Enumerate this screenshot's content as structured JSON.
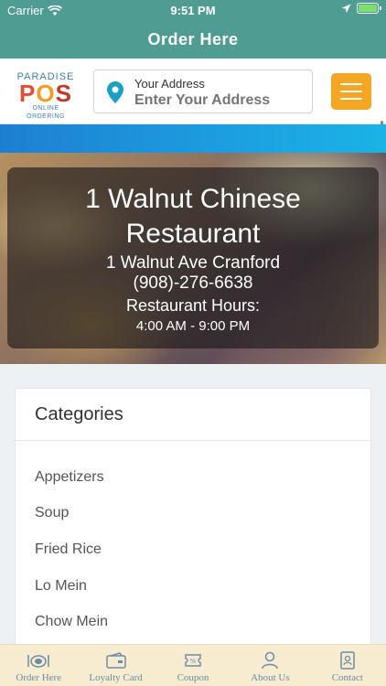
{
  "status_bar": {
    "carrier": "Carrier",
    "time": "9:51 PM"
  },
  "nav": {
    "title": "Order Here"
  },
  "logo": {
    "line1": "PARADISE",
    "line2": "POS",
    "line3": "ONLINE ORDERING"
  },
  "address": {
    "label": "Your Address",
    "placeholder": "Enter Your Address",
    "value": ""
  },
  "hero": {
    "name": "1 Walnut Chinese Restaurant",
    "address": "1 Walnut Ave Cranford",
    "phone": "(908)-276-6638",
    "hours_label": "Restaurant Hours:",
    "hours": "4:00 AM - 9:00 PM"
  },
  "categories": {
    "title": "Categories",
    "items": [
      "Appetizers",
      "Soup",
      "Fried Rice",
      "Lo Mein",
      "Chow Mein"
    ]
  },
  "tabbar": {
    "items": [
      {
        "label": "Order Here",
        "icon": "dish-icon"
      },
      {
        "label": "Loyalty Card",
        "icon": "card-icon"
      },
      {
        "label": "Coupon",
        "icon": "coupon-icon"
      },
      {
        "label": "About Us",
        "icon": "person-icon"
      },
      {
        "label": "Contact",
        "icon": "contact-icon"
      }
    ]
  },
  "colors": {
    "teal": "#4f9c93",
    "orange": "#f5a623",
    "blue": "#1c9fe0",
    "tabbar": "#f7ecd0"
  }
}
